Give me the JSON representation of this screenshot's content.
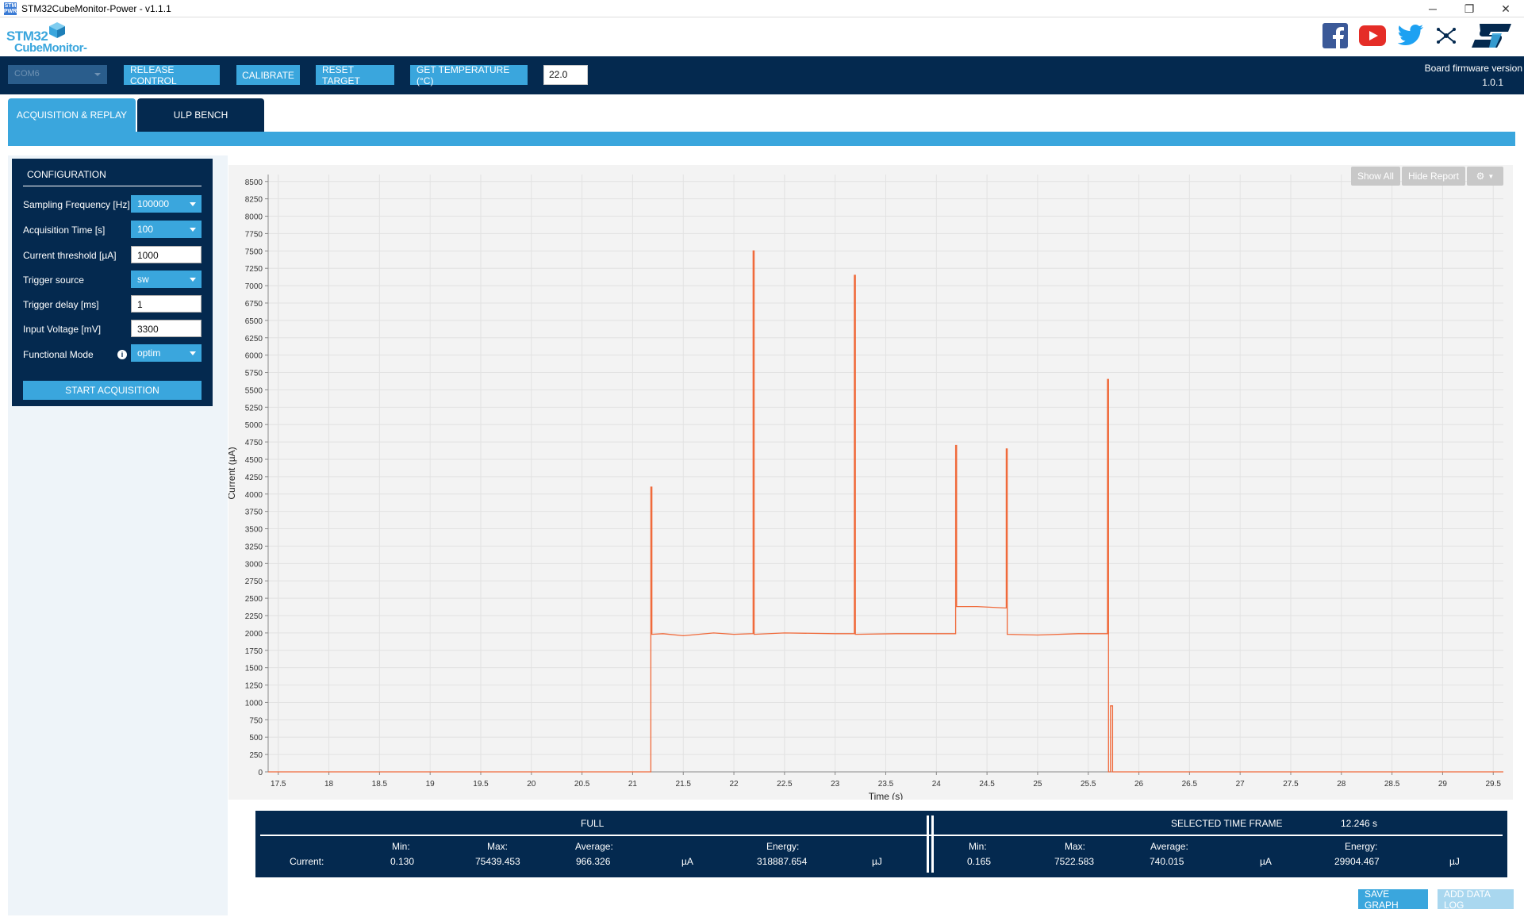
{
  "window": {
    "title": "STM32CubeMonitor-Power - v1.1.1",
    "app_icon_text": "STM PWR",
    "minimize": "─",
    "restore": "❐",
    "close": "✕"
  },
  "logo": {
    "line1": "STM32",
    "line2": "CubeMonitor-Power"
  },
  "social": [
    "facebook-icon",
    "youtube-icon",
    "twitter-icon",
    "network-icon",
    "st-logo"
  ],
  "toolbar": {
    "port_select": "COM6",
    "release_control": "RELEASE CONTROL",
    "calibrate": "CALIBRATE",
    "reset_target": "RESET TARGET",
    "get_temperature": "GET TEMPERATURE (°C)",
    "temperature_value": "22.0",
    "firmware_label": "Board firmware version",
    "firmware_value": "1.0.1"
  },
  "tabs": [
    "ACQUISITION & REPLAY",
    "ULP BENCH"
  ],
  "config": {
    "title": "CONFIGURATION",
    "rows": [
      {
        "label": "Sampling Frequency [Hz]",
        "type": "select",
        "value": "100000"
      },
      {
        "label": "Acquisition Time [s]",
        "type": "select",
        "value": "100"
      },
      {
        "label": "Current threshold [µA]",
        "type": "input",
        "value": "1000"
      },
      {
        "label": "Trigger source",
        "type": "select",
        "value": "sw"
      },
      {
        "label": "Trigger delay [ms]",
        "type": "input",
        "value": "1"
      },
      {
        "label": "Input Voltage [mV]",
        "type": "input",
        "value": "3300"
      },
      {
        "label": "Functional Mode",
        "type": "select",
        "value": "optim"
      }
    ],
    "start_button": "START ACQUISITION"
  },
  "chart_buttons": {
    "show_all": "Show All",
    "hide_report": "Hide Report"
  },
  "chart_data": {
    "type": "line",
    "title": "",
    "xlabel": "Time (s)",
    "ylabel": "Current (µA)",
    "xlim": [
      17.4,
      29.6
    ],
    "ylim": [
      0,
      8600
    ],
    "xticks": [
      17.5,
      18,
      18.5,
      19,
      19.5,
      20,
      20.5,
      21,
      21.5,
      22,
      22.5,
      23,
      23.5,
      24,
      24.5,
      25,
      25.5,
      26,
      26.5,
      27,
      27.5,
      28,
      28.5,
      29,
      29.5
    ],
    "yticks": [
      0,
      250,
      500,
      750,
      1000,
      1250,
      1500,
      1750,
      2000,
      2250,
      2500,
      2750,
      3000,
      3250,
      3500,
      3750,
      4000,
      4250,
      4500,
      4750,
      5000,
      5250,
      5500,
      5750,
      6000,
      6250,
      6500,
      6750,
      7000,
      7250,
      7500,
      7750,
      8000,
      8250,
      8500
    ],
    "grid": true,
    "color": "#f06a3b",
    "series": [
      {
        "x": [
          17.4,
          21.18,
          21.18,
          21.19,
          21.19,
          21.3,
          21.5,
          21.8,
          22.0,
          22.19,
          22.19,
          22.2,
          22.2,
          22.5,
          23.0,
          23.19,
          23.19,
          23.2,
          23.2,
          23.6,
          24.18,
          24.19,
          24.19,
          24.2,
          24.2,
          24.4,
          24.68,
          24.69,
          24.69,
          24.7,
          24.7,
          25.0,
          25.4,
          25.67,
          25.69,
          25.69,
          25.7,
          25.7,
          25.72,
          25.72,
          25.74,
          25.74,
          25.76,
          25.76,
          29.6
        ],
        "y": [
          0,
          0,
          4100,
          4100,
          1980,
          1990,
          1960,
          2000,
          1980,
          1990,
          7500,
          7500,
          1980,
          2000,
          1990,
          1990,
          7150,
          7150,
          1980,
          1990,
          1990,
          1990,
          4700,
          4700,
          2380,
          2380,
          2360,
          2360,
          4650,
          4650,
          1980,
          1970,
          1990,
          1990,
          1990,
          5650,
          5650,
          0,
          0,
          950,
          950,
          0,
          0,
          0,
          0
        ]
      }
    ]
  },
  "stats": {
    "full_title": "FULL",
    "selected_title": "SELECTED TIME FRAME",
    "selected_duration": "12.246 s",
    "row_label": "Current:",
    "headers": {
      "min": "Min:",
      "max": "Max:",
      "average": "Average:",
      "energy": "Energy:"
    },
    "current_unit": "µA",
    "energy_unit": "µJ",
    "full": {
      "min": "0.130",
      "max": "75439.453",
      "average": "966.326",
      "energy": "318887.654"
    },
    "selected": {
      "min": "0.165",
      "max": "7522.583",
      "average": "740.015",
      "energy": "29904.467"
    }
  },
  "bottom_buttons": {
    "save_graph": "SAVE GRAPH",
    "add_data_log": "ADD DATA LOG"
  }
}
